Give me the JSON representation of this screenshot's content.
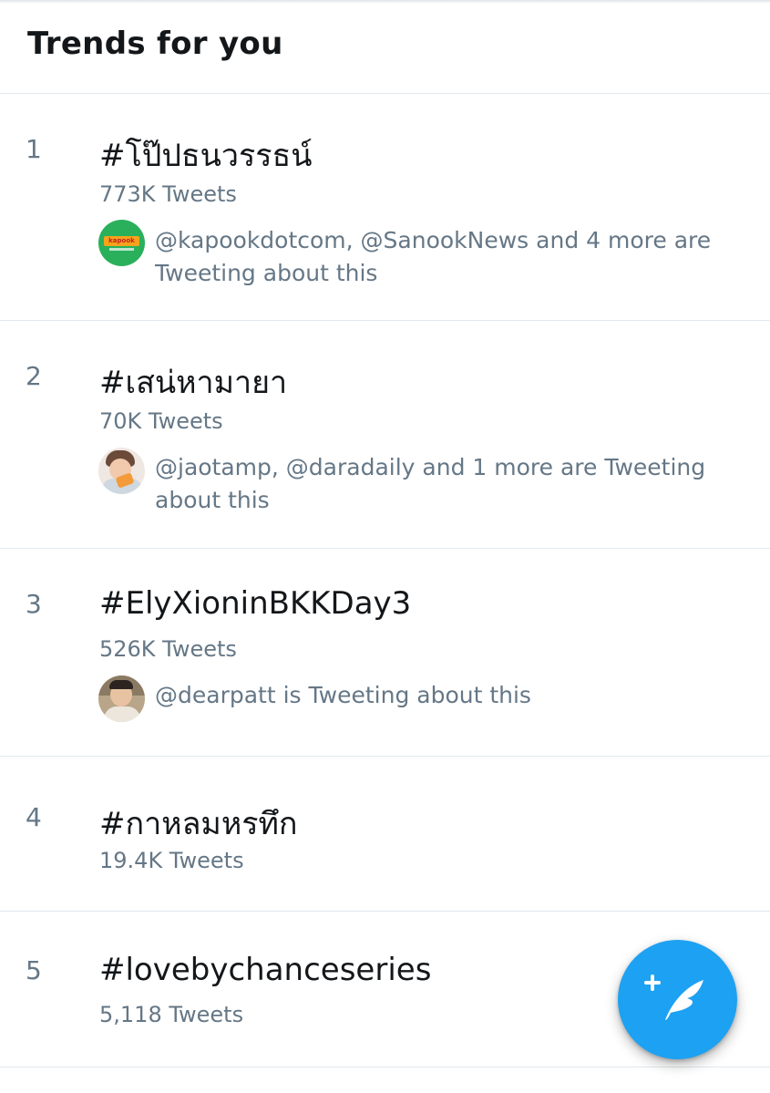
{
  "header": {
    "title": "Trends for you"
  },
  "trends": [
    {
      "rank": "1",
      "hashtag": "#โป๊ปธนวรรธน์",
      "tweets": "773K Tweets",
      "context": "@kapookdotcom, @SanookNews and 4 more are Tweeting about this",
      "avatar_icon": "kapook-logo-avatar",
      "avatar_text": "kapook"
    },
    {
      "rank": "2",
      "hashtag": "#เสน่หามายา",
      "tweets": "70K Tweets",
      "context": "@jaotamp, @daradaily and 1 more are Tweeting about this",
      "avatar_icon": "user-photo-avatar"
    },
    {
      "rank": "3",
      "hashtag": "#ElyXioninBKKDay3",
      "tweets": "526K Tweets",
      "context": "@dearpatt is Tweeting about this",
      "avatar_icon": "user-photo-avatar"
    },
    {
      "rank": "4",
      "hashtag": "#กาหลมหรทึก",
      "tweets": "19.4K Tweets"
    },
    {
      "rank": "5",
      "hashtag": "#lovebychanceseries",
      "tweets": "5,118 Tweets"
    }
  ],
  "fab": {
    "icon": "compose-tweet-icon"
  },
  "colors": {
    "accent": "#1da1f2",
    "secondary_text": "#657786",
    "primary_text": "#14171a",
    "divider": "#e1e8ed"
  }
}
